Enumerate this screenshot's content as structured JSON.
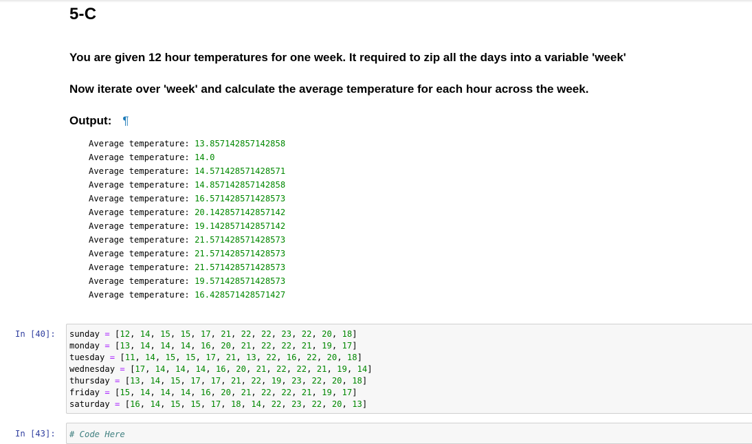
{
  "markdown": {
    "heading": "5-C",
    "para1": "You are given 12 hour temperatures for one week. It required to zip all the days into a variable 'week'",
    "para2": "Now iterate over 'week' and calculate the average temperature for each hour across the week.",
    "output_heading": "Output:",
    "anchor": "¶"
  },
  "output": {
    "label": "Average temperature:",
    "values": [
      "13.857142857142858",
      "14.0",
      "14.571428571428571",
      "14.857142857142858",
      "16.571428571428573",
      "20.142857142857142",
      "19.142857142857142",
      "21.571428571428573",
      "21.571428571428573",
      "21.571428571428573",
      "19.571428571428573",
      "16.428571428571427"
    ]
  },
  "cells": [
    {
      "prompt": "In [40]:",
      "lines": [
        {
          "name": "sunday",
          "values": "12, 14, 15, 15, 17, 21, 22, 22, 23, 22, 20, 18"
        },
        {
          "name": "monday",
          "values": "13, 14, 14, 14, 16, 20, 21, 22, 22, 21, 19, 17"
        },
        {
          "name": "tuesday",
          "values": "11, 14, 15, 15, 17, 21, 13, 22, 16, 22, 20, 18"
        },
        {
          "name": "wednesday",
          "values": "17, 14, 14, 14, 16, 20, 21, 22, 22, 21, 19, 14"
        },
        {
          "name": "thursday",
          "values": "13, 14, 15, 17, 17, 21, 22, 19, 23, 22, 20, 18"
        },
        {
          "name": "friday",
          "values": "15, 14, 14, 14, 16, 20, 21, 22, 22, 21, 19, 17"
        },
        {
          "name": "saturday",
          "values": "16, 14, 15, 15, 17, 18, 14, 22, 23, 22, 20, 13"
        }
      ]
    },
    {
      "prompt": "In [43]:",
      "comment": "# Code Here"
    }
  ]
}
